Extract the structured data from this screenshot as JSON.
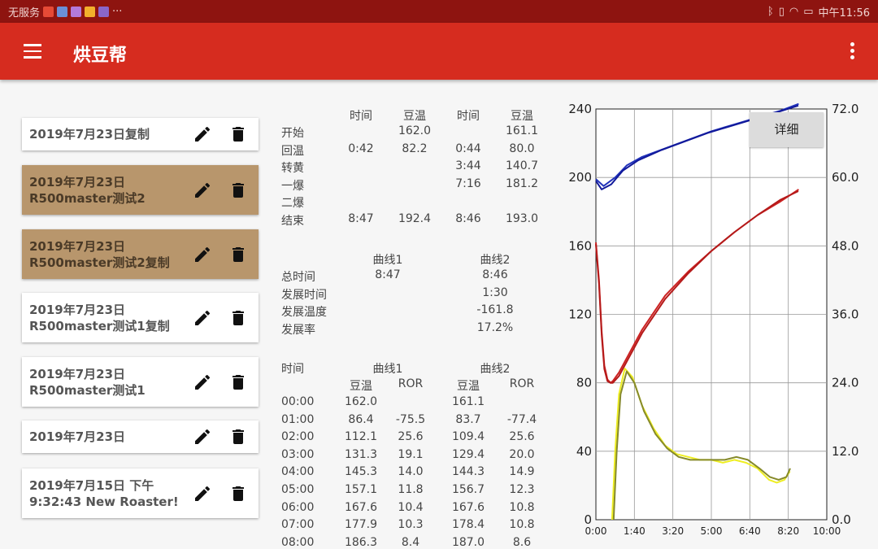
{
  "status": {
    "carrier": "无服务",
    "more": "···",
    "time": "中午11:56",
    "icon_colors": [
      "#e64a36",
      "#6a8fd8",
      "#b479d9",
      "#f2b02c",
      "#8a66c9"
    ]
  },
  "appbar": {
    "title": "烘豆帮",
    "menu_icon": "hamburger-menu-icon",
    "overflow_icon": "more-vert-icon"
  },
  "profiles": [
    {
      "label": "2019年7月23日复制",
      "selected": false
    },
    {
      "label": "2019年7月23日\nR500master测试2",
      "selected": true
    },
    {
      "label": "2019年7月23日\nR500master测试2复制",
      "selected": true
    },
    {
      "label": "2019年7月23日\nR500master测试1复制",
      "selected": false
    },
    {
      "label": "2019年7月23日\nR500master测试1",
      "selected": false
    },
    {
      "label": "2019年7月23日",
      "selected": false
    },
    {
      "label": "2019年7月15日 下午\n9:32:43 New Roaster!",
      "selected": false
    }
  ],
  "events": {
    "headers": [
      "时间",
      "豆温",
      "时间",
      "豆温"
    ],
    "rows": [
      {
        "name": "开始",
        "t1": "",
        "bt1": "162.0",
        "t2": "",
        "bt2": "161.1"
      },
      {
        "name": "回温",
        "t1": "0:42",
        "bt1": "82.2",
        "t2": "0:44",
        "bt2": "80.0"
      },
      {
        "name": "转黄",
        "t1": "",
        "bt1": "",
        "t2": "3:44",
        "bt2": "140.7"
      },
      {
        "name": "一爆",
        "t1": "",
        "bt1": "",
        "t2": "7:16",
        "bt2": "181.2"
      },
      {
        "name": "二爆",
        "t1": "",
        "bt1": "",
        "t2": "",
        "bt2": ""
      },
      {
        "name": "结束",
        "t1": "8:47",
        "bt1": "192.4",
        "t2": "8:46",
        "bt2": "193.0"
      }
    ]
  },
  "summary": {
    "headers": [
      "曲线1",
      "曲线2"
    ],
    "rows": [
      {
        "name": "总时间",
        "v1": "8:47",
        "v2": "8:46"
      },
      {
        "name": "发展时间",
        "v1": "",
        "v2": "1:30"
      },
      {
        "name": "发展温度",
        "v1": "",
        "v2": "-161.8"
      },
      {
        "name": "发展率",
        "v1": "",
        "v2": "17.2%"
      }
    ]
  },
  "timeline": {
    "time_label": "时间",
    "curve_labels": [
      "曲线1",
      "曲线2"
    ],
    "sub_headers": [
      "豆温",
      "ROR",
      "豆温",
      "ROR"
    ],
    "rows": [
      [
        "00:00",
        "162.0",
        "",
        "161.1",
        ""
      ],
      [
        "01:00",
        "86.4",
        "-75.5",
        "83.7",
        "-77.4"
      ],
      [
        "02:00",
        "112.1",
        "25.6",
        "109.4",
        "25.6"
      ],
      [
        "03:00",
        "131.3",
        "19.1",
        "129.4",
        "20.0"
      ],
      [
        "04:00",
        "145.3",
        "14.0",
        "144.3",
        "14.9"
      ],
      [
        "05:00",
        "157.1",
        "11.8",
        "156.7",
        "12.3"
      ],
      [
        "06:00",
        "167.6",
        "10.4",
        "167.6",
        "10.8"
      ],
      [
        "07:00",
        "177.9",
        "10.3",
        "178.4",
        "10.8"
      ],
      [
        "08:00",
        "186.3",
        "8.4",
        "187.0",
        "8.6"
      ]
    ]
  },
  "detail_button": "详细",
  "chart_data": {
    "type": "line",
    "x_ticks": [
      "0:00",
      "1:40",
      "3:20",
      "5:00",
      "6:40",
      "8:20",
      "10:00"
    ],
    "xlim": [
      0,
      600
    ],
    "y_left_ticks": [
      "0",
      "40",
      "80",
      "120",
      "160",
      "200",
      "240"
    ],
    "ylim_left": [
      0,
      240
    ],
    "y_right_ticks": [
      "0.0",
      "12.0",
      "24.0",
      "36.0",
      "48.0",
      "60.0",
      "72.0"
    ],
    "ylim_right": [
      0,
      72
    ],
    "grid": true,
    "series": [
      {
        "axis": "left",
        "color": "#cc2222",
        "points": [
          [
            0,
            162
          ],
          [
            8,
            140
          ],
          [
            15,
            110
          ],
          [
            22,
            90
          ],
          [
            30,
            82
          ],
          [
            38,
            80
          ],
          [
            44,
            81
          ],
          [
            60,
            86
          ],
          [
            120,
            111
          ],
          [
            180,
            131
          ],
          [
            240,
            145
          ],
          [
            300,
            157
          ],
          [
            360,
            168
          ],
          [
            420,
            178
          ],
          [
            480,
            186
          ],
          [
            527,
            193
          ]
        ]
      },
      {
        "axis": "left",
        "color": "#b41a1a",
        "points": [
          [
            0,
            161
          ],
          [
            8,
            138
          ],
          [
            15,
            108
          ],
          [
            22,
            88
          ],
          [
            30,
            81
          ],
          [
            38,
            80
          ],
          [
            44,
            80
          ],
          [
            60,
            84
          ],
          [
            120,
            109
          ],
          [
            180,
            129
          ],
          [
            240,
            144
          ],
          [
            300,
            157
          ],
          [
            360,
            168
          ],
          [
            420,
            178
          ],
          [
            480,
            187
          ],
          [
            526,
            192
          ]
        ]
      },
      {
        "axis": "left",
        "color": "#2233bb",
        "points": [
          [
            0,
            199
          ],
          [
            20,
            195
          ],
          [
            50,
            200
          ],
          [
            80,
            207
          ],
          [
            120,
            212
          ],
          [
            180,
            217
          ],
          [
            240,
            222
          ],
          [
            300,
            227
          ],
          [
            360,
            231
          ],
          [
            420,
            235
          ],
          [
            480,
            239
          ],
          [
            527,
            243
          ]
        ]
      },
      {
        "axis": "left",
        "color": "#11199a",
        "points": [
          [
            0,
            198
          ],
          [
            15,
            193
          ],
          [
            40,
            196
          ],
          [
            70,
            204
          ],
          [
            110,
            210
          ],
          [
            170,
            216
          ],
          [
            230,
            221
          ],
          [
            290,
            226
          ],
          [
            350,
            230
          ],
          [
            410,
            234
          ],
          [
            470,
            238
          ],
          [
            526,
            242
          ]
        ]
      },
      {
        "axis": "right",
        "color": "#eeee22",
        "points": [
          [
            42,
            0
          ],
          [
            50,
            12
          ],
          [
            60,
            22
          ],
          [
            75,
            26.5
          ],
          [
            95,
            25
          ],
          [
            120,
            20
          ],
          [
            150,
            16
          ],
          [
            180,
            13
          ],
          [
            210,
            11.5
          ],
          [
            240,
            11
          ],
          [
            270,
            10.5
          ],
          [
            300,
            10.5
          ],
          [
            330,
            10
          ],
          [
            360,
            10.5
          ],
          [
            390,
            10
          ],
          [
            420,
            9
          ],
          [
            450,
            7
          ],
          [
            470,
            6.5
          ],
          [
            490,
            7
          ],
          [
            504,
            8.5
          ]
        ]
      },
      {
        "axis": "right",
        "color": "#868a2a",
        "points": [
          [
            46,
            0
          ],
          [
            54,
            12
          ],
          [
            64,
            22
          ],
          [
            80,
            26
          ],
          [
            100,
            24
          ],
          [
            125,
            19
          ],
          [
            155,
            15
          ],
          [
            185,
            12.5
          ],
          [
            215,
            11
          ],
          [
            245,
            10.5
          ],
          [
            275,
            10.5
          ],
          [
            305,
            10.5
          ],
          [
            335,
            10.5
          ],
          [
            365,
            11
          ],
          [
            395,
            10.5
          ],
          [
            425,
            9
          ],
          [
            452,
            7.5
          ],
          [
            475,
            7
          ],
          [
            495,
            7.5
          ],
          [
            505,
            9
          ]
        ]
      }
    ]
  }
}
